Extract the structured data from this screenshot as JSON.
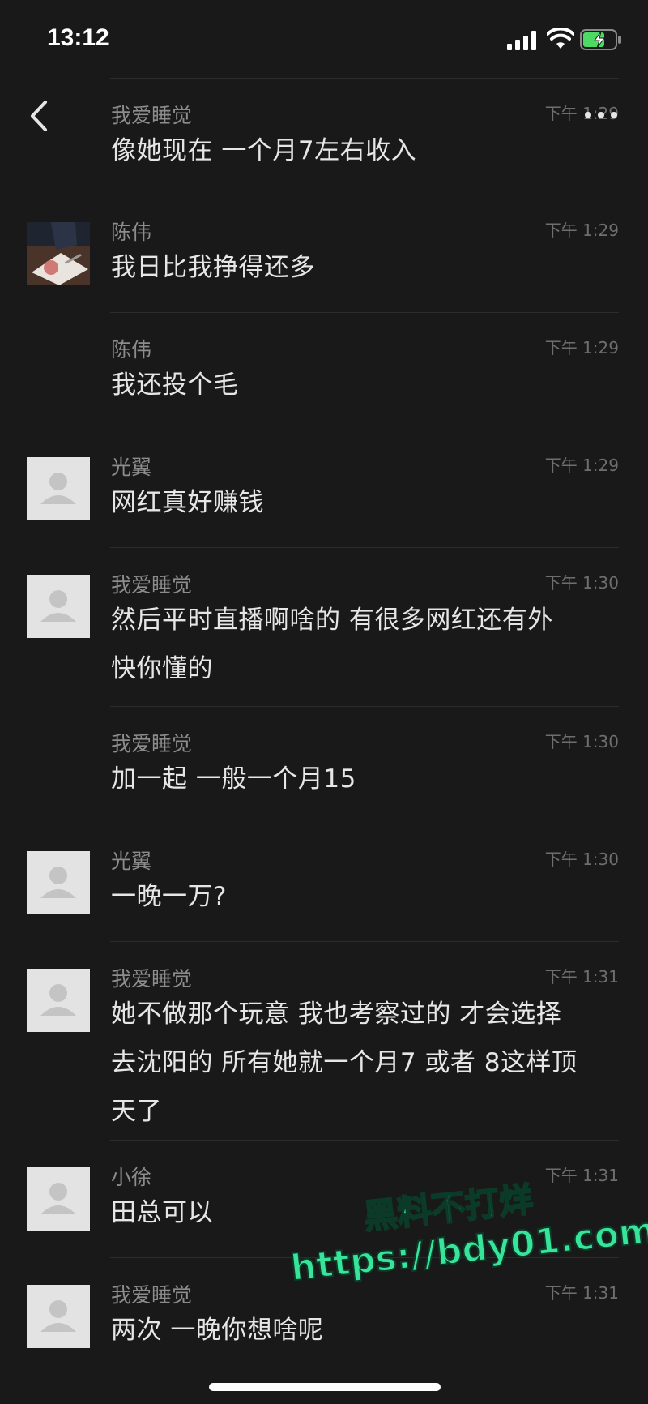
{
  "status_bar": {
    "time": "13:12"
  },
  "messages": [
    {
      "sender": "我爱睡觉",
      "time": "下午 1:29",
      "text": [
        "像她现在 一个月7左右收入"
      ],
      "avatar": "none"
    },
    {
      "sender": "陈伟",
      "time": "下午 1:29",
      "text": [
        "我日比我挣得还多"
      ],
      "avatar": "photo"
    },
    {
      "sender": "陈伟",
      "time": "下午 1:29",
      "text": [
        "我还投个毛"
      ],
      "avatar": "none"
    },
    {
      "sender": "光翼",
      "time": "下午 1:29",
      "text": [
        "网红真好赚钱"
      ],
      "avatar": "default"
    },
    {
      "sender": "我爱睡觉",
      "time": "下午 1:30",
      "text": [
        "然后平时直播啊啥的 有很多网红还有外",
        "快你懂的"
      ],
      "avatar": "default"
    },
    {
      "sender": "我爱睡觉",
      "time": "下午 1:30",
      "text": [
        "加一起 一般一个月15"
      ],
      "avatar": "none"
    },
    {
      "sender": "光翼",
      "time": "下午 1:30",
      "text": [
        "一晚一万?"
      ],
      "avatar": "default"
    },
    {
      "sender": "我爱睡觉",
      "time": "下午 1:31",
      "text": [
        "她不做那个玩意 我也考察过的 才会选择",
        "去沈阳的 所有她就一个月7 或者 8这样顶",
        "天了"
      ],
      "avatar": "default"
    },
    {
      "sender": "小徐",
      "time": "下午 1:31",
      "text": [
        "田总可以"
      ],
      "avatar": "default"
    },
    {
      "sender": "我爱睡觉",
      "time": "下午 1:31",
      "text": [
        "两次 一晚你想啥呢"
      ],
      "avatar": "default"
    }
  ],
  "watermark": {
    "line1": "黑料不打烊",
    "line2": "https://bdy01.com",
    "color": "#38e39a"
  }
}
